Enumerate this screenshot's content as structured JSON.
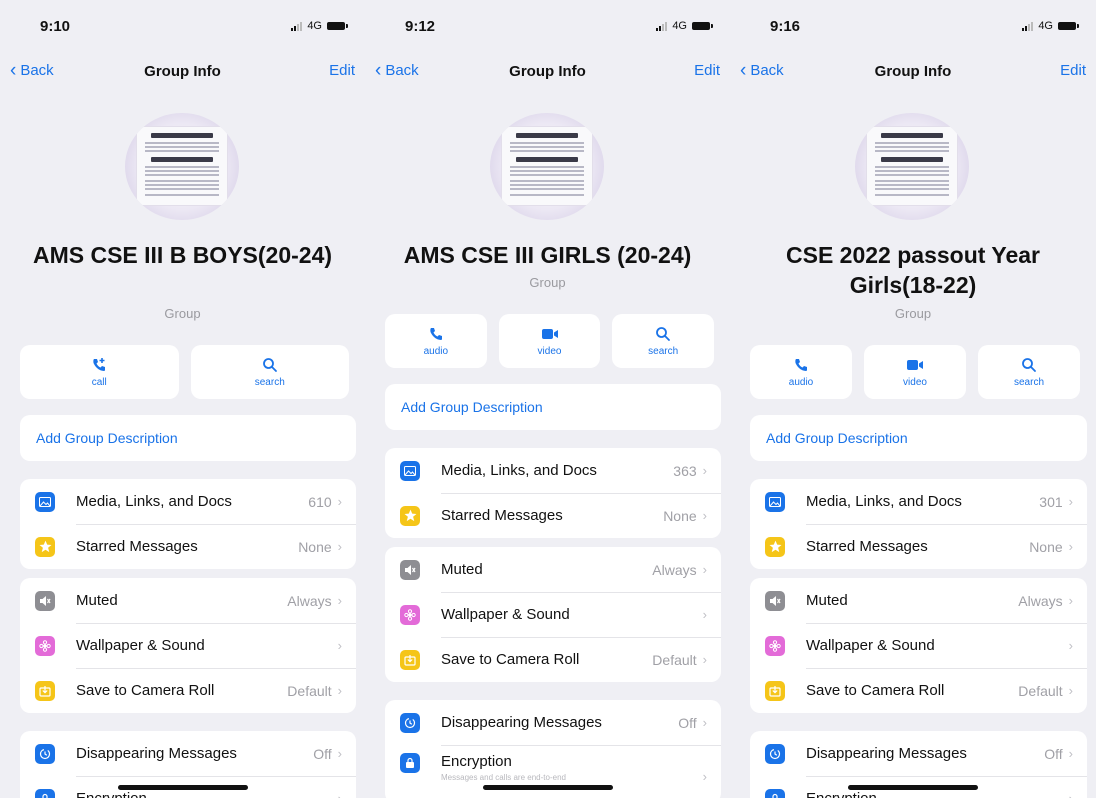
{
  "screens": [
    {
      "status": {
        "time": "9:10",
        "network": "4G"
      },
      "nav": {
        "back": "Back",
        "title": "Group Info",
        "edit": "Edit"
      },
      "group_name": "AMS CSE III B BOYS(20-24)",
      "group_type": "Group",
      "actions": [
        {
          "label": "call",
          "icon": "phone-plus-icon"
        },
        {
          "label": "search",
          "icon": "search-icon"
        }
      ],
      "add_description": "Add Group Description",
      "section1": [
        {
          "label": "Media, Links, and Docs",
          "value": "610",
          "icon": "photo-icon",
          "color": "#1a73e8"
        },
        {
          "label": "Starred Messages",
          "value": "None",
          "icon": "star-icon",
          "color": "#f5c518"
        }
      ],
      "section2": [
        {
          "label": "Muted",
          "value": "Always",
          "icon": "mute-icon",
          "color": "#8e8e93"
        },
        {
          "label": "Wallpaper & Sound",
          "value": "",
          "icon": "flower-icon",
          "color": "#e36bd8"
        },
        {
          "label": "Save to Camera Roll",
          "value": "Default",
          "icon": "download-icon",
          "color": "#f5c518"
        }
      ],
      "section3": [
        {
          "label": "Disappearing Messages",
          "value": "Off",
          "icon": "timer-icon",
          "color": "#1a73e8"
        },
        {
          "label": "Encryption",
          "value": "",
          "icon": "lock-icon",
          "color": "#1a73e8"
        }
      ]
    },
    {
      "status": {
        "time": "9:12",
        "network": "4G"
      },
      "nav": {
        "back": "Back",
        "title": "Group Info",
        "edit": "Edit"
      },
      "group_name": "AMS CSE III GIRLS (20-24)",
      "group_type": "Group",
      "actions": [
        {
          "label": "audio",
          "icon": "phone-icon"
        },
        {
          "label": "video",
          "icon": "video-icon"
        },
        {
          "label": "search",
          "icon": "search-icon"
        }
      ],
      "add_description": "Add Group Description",
      "section1": [
        {
          "label": "Media, Links, and Docs",
          "value": "363",
          "icon": "photo-icon",
          "color": "#1a73e8"
        },
        {
          "label": "Starred Messages",
          "value": "None",
          "icon": "star-icon",
          "color": "#f5c518"
        }
      ],
      "section2": [
        {
          "label": "Muted",
          "value": "Always",
          "icon": "mute-icon",
          "color": "#8e8e93"
        },
        {
          "label": "Wallpaper & Sound",
          "value": "",
          "icon": "flower-icon",
          "color": "#e36bd8"
        },
        {
          "label": "Save to Camera Roll",
          "value": "Default",
          "icon": "download-icon",
          "color": "#f5c518"
        }
      ],
      "section3": [
        {
          "label": "Disappearing Messages",
          "value": "Off",
          "icon": "timer-icon",
          "color": "#1a73e8"
        },
        {
          "label": "Encryption",
          "value": "",
          "icon": "lock-icon",
          "color": "#1a73e8",
          "sub": "Messages and calls are end-to-end"
        }
      ]
    },
    {
      "status": {
        "time": "9:16",
        "network": "4G"
      },
      "nav": {
        "back": "Back",
        "title": "Group Info",
        "edit": "Edit"
      },
      "group_name": "CSE 2022 passout Year Girls(18-22)",
      "group_type": "Group",
      "actions": [
        {
          "label": "audio",
          "icon": "phone-icon"
        },
        {
          "label": "video",
          "icon": "video-icon"
        },
        {
          "label": "search",
          "icon": "search-icon"
        }
      ],
      "add_description": "Add Group Description",
      "section1": [
        {
          "label": "Media, Links, and Docs",
          "value": "301",
          "icon": "photo-icon",
          "color": "#1a73e8"
        },
        {
          "label": "Starred Messages",
          "value": "None",
          "icon": "star-icon",
          "color": "#f5c518"
        }
      ],
      "section2": [
        {
          "label": "Muted",
          "value": "Always",
          "icon": "mute-icon",
          "color": "#8e8e93"
        },
        {
          "label": "Wallpaper & Sound",
          "value": "",
          "icon": "flower-icon",
          "color": "#e36bd8"
        },
        {
          "label": "Save to Camera Roll",
          "value": "Default",
          "icon": "download-icon",
          "color": "#f5c518"
        }
      ],
      "section3": [
        {
          "label": "Disappearing Messages",
          "value": "Off",
          "icon": "timer-icon",
          "color": "#1a73e8"
        },
        {
          "label": "Encryption",
          "value": "",
          "icon": "lock-icon",
          "color": "#1a73e8"
        }
      ]
    }
  ]
}
